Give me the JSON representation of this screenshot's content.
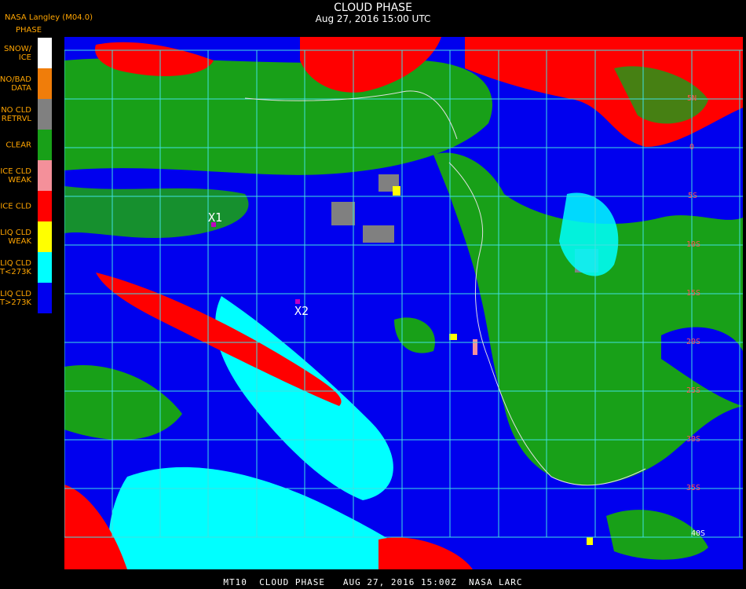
{
  "header": {
    "title": "CLOUD PHASE",
    "datetime": "Aug 27, 2016 15:00 UTC"
  },
  "agency_label": "NASA Langley (M04.0)",
  "legend": {
    "title": "PHASE",
    "items": [
      {
        "label": "SNOW/\nICE",
        "color": "#ffffff"
      },
      {
        "label": "NO/BAD\nDATA",
        "color": "#f07d0a"
      },
      {
        "label": "NO CLD\nRETRVL",
        "color": "#808080"
      },
      {
        "label": "CLEAR",
        "color": "#18a018"
      },
      {
        "label": "ICE CLD\nWEAK",
        "color": "#f4909a"
      },
      {
        "label": "ICE CLD",
        "color": "#ff0000"
      },
      {
        "label": "LIQ CLD\nWEAK",
        "color": "#ffff00"
      },
      {
        "label": "LIQ CLD\nT<273K",
        "color": "#00ffff"
      },
      {
        "label": "LIQ CLD\nT>273K",
        "color": "#0000ee"
      }
    ]
  },
  "markers": [
    {
      "label": "X1",
      "color": "#c000c0"
    },
    {
      "label": "X2",
      "color": "#c000c0"
    }
  ],
  "latitude_labels": [
    "5N",
    "0",
    "5S",
    "10S",
    "15S",
    "20S",
    "25S",
    "30S",
    "35S",
    "40S"
  ],
  "footer": "MT10  CLOUD PHASE   AUG 27, 2016 15:00Z  NASA LARC"
}
